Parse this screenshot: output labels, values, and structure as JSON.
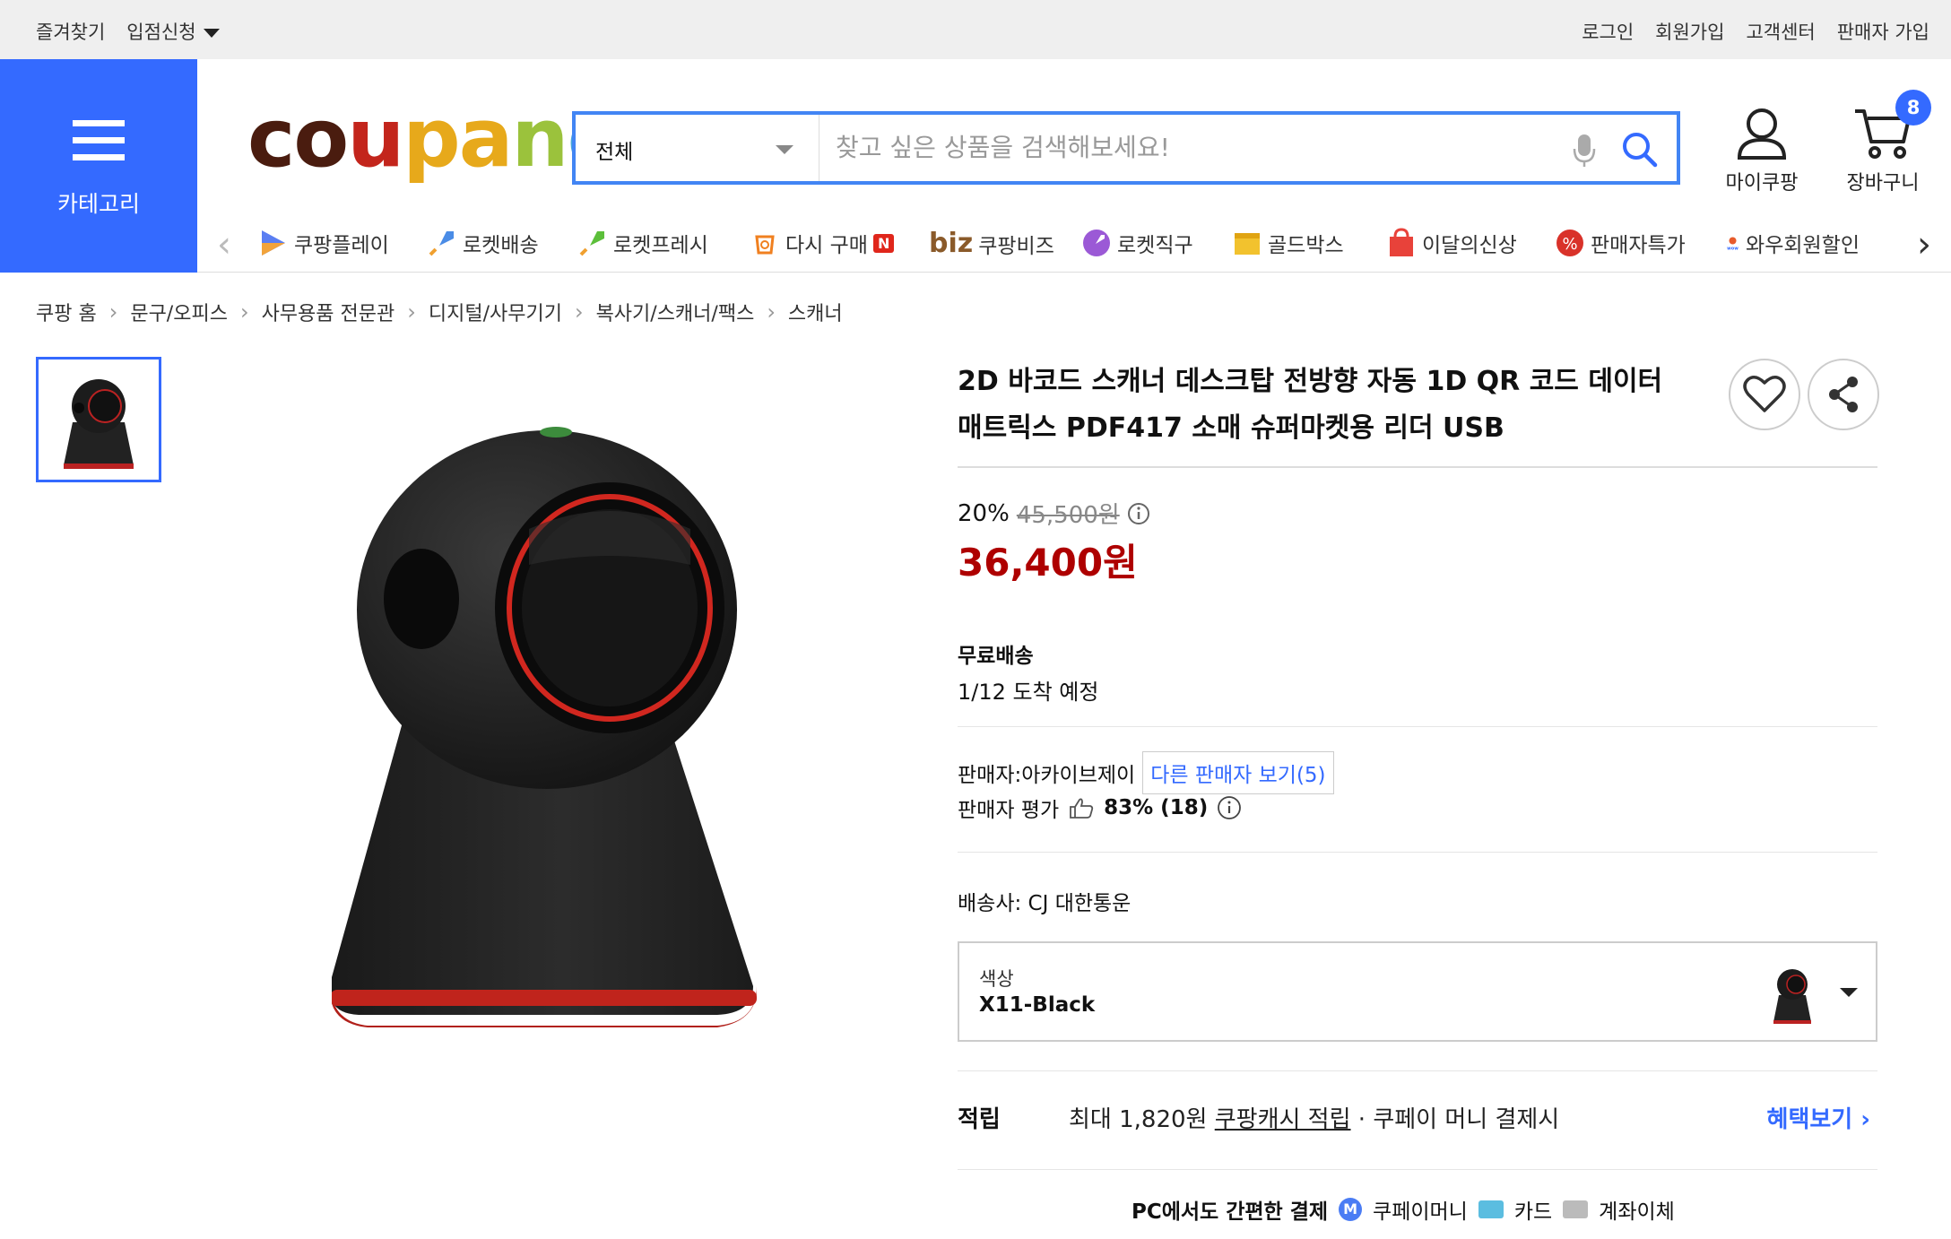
{
  "topbar": {
    "favorites": "즐겨찾기",
    "seller_apply": "입점신청",
    "login": "로그인",
    "signup": "회원가입",
    "support": "고객센터",
    "seller_signup": "판매자 가입"
  },
  "category": {
    "label": "카테고리"
  },
  "logo": {
    "text": "coupang"
  },
  "search": {
    "scope": "전체",
    "placeholder": "찾고 싶은 상품을 검색해보세요!"
  },
  "header": {
    "my_coupang": "마이쿠팡",
    "cart": "장바구니",
    "cart_count": "8"
  },
  "services": [
    {
      "label": "쿠팡플레이",
      "icon": "play-icon"
    },
    {
      "label": "로켓배송",
      "icon": "rocket-icon"
    },
    {
      "label": "로켓프레시",
      "icon": "rocket-fresh-icon"
    },
    {
      "label": "다시 구매",
      "icon": "rebuy-icon",
      "badge": "N"
    },
    {
      "label": "쿠팡비즈",
      "icon": "biz-icon",
      "prefix": "biz"
    },
    {
      "label": "로켓직구",
      "icon": "rocket-global-icon"
    },
    {
      "label": "골드박스",
      "icon": "goldbox-icon"
    },
    {
      "label": "이달의신상",
      "icon": "new-icon"
    },
    {
      "label": "판매자특가",
      "icon": "seller-deal-icon"
    },
    {
      "label": "와우회원할인",
      "icon": "wow-icon"
    }
  ],
  "breadcrumbs": [
    "쿠팡 홈",
    "문구/오피스",
    "사무용품 전문관",
    "디지털/사무기기",
    "복사기/스캐너/팩스",
    "스캐너"
  ],
  "product": {
    "title": "2D 바코드 스캐너 데스크탑 전방향 자동 1D QR 코드 데이터 매트릭스 PDF417 소매 슈퍼마켓용 리더 USB",
    "discount_rate": "20%",
    "original_price": "45,500원",
    "price": "36,400원",
    "shipping_type": "무료배송",
    "arrival": "1/12 도착 예정",
    "seller_label": "판매자:아카이브제이",
    "other_sellers": "다른 판매자 보기(5)",
    "seller_rating_label": "판매자 평가",
    "seller_rating": "83% (18)",
    "carrier": "배송사:  CJ 대한통운",
    "option_label": "색상",
    "option_value": "X11-Black"
  },
  "reward": {
    "label": "적립",
    "max": "최대 1,820원",
    "cash": "쿠팡캐시 적립",
    "method": "· 쿠페이 머니 결제시",
    "more": "혜택보기 ›"
  },
  "payment": {
    "title": "PC에서도 간편한 결제",
    "m_icon": "M",
    "money": "쿠페이머니",
    "card": "카드",
    "bank": "계좌이체"
  },
  "colors": {
    "accent": "#346aff",
    "price": "#ae0000",
    "search_border": "#4285f4"
  }
}
